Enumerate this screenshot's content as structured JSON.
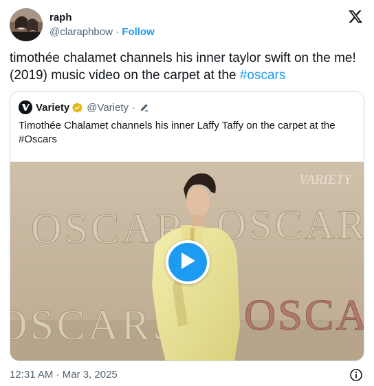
{
  "tweet": {
    "author": {
      "display_name": "raph",
      "handle": "@claraphbow",
      "separator": "·",
      "follow_label": "Follow"
    },
    "text_parts": {
      "body": "timothée chalamet channels his inner taylor swift on the me! (2019) music video on the carpet at the ",
      "hashtag": "#oscars"
    },
    "timestamp": "12:31 AM · Mar 3, 2025"
  },
  "quote": {
    "author": {
      "display_name": "Variety",
      "handle": "@Variety",
      "separator": "·"
    },
    "text": "Timothée Chalamet channels his inner Laffy Taffy on the carpet at the #Oscars",
    "video": {
      "watermark": "VARIETY",
      "backdrop_words": [
        "OSCAR",
        "OSCAR",
        "OSCA",
        "OSCARS"
      ]
    }
  },
  "colors": {
    "accent": "#1d9bf0",
    "text_primary": "#0f1419",
    "text_secondary": "#536471",
    "border": "#cfd9de",
    "verified_gold": "#e2b719"
  },
  "icons": [
    "x-logo-icon",
    "variety-logo-icon",
    "verified-badge-icon",
    "edit-pencil-icon",
    "play-icon",
    "info-icon"
  ]
}
